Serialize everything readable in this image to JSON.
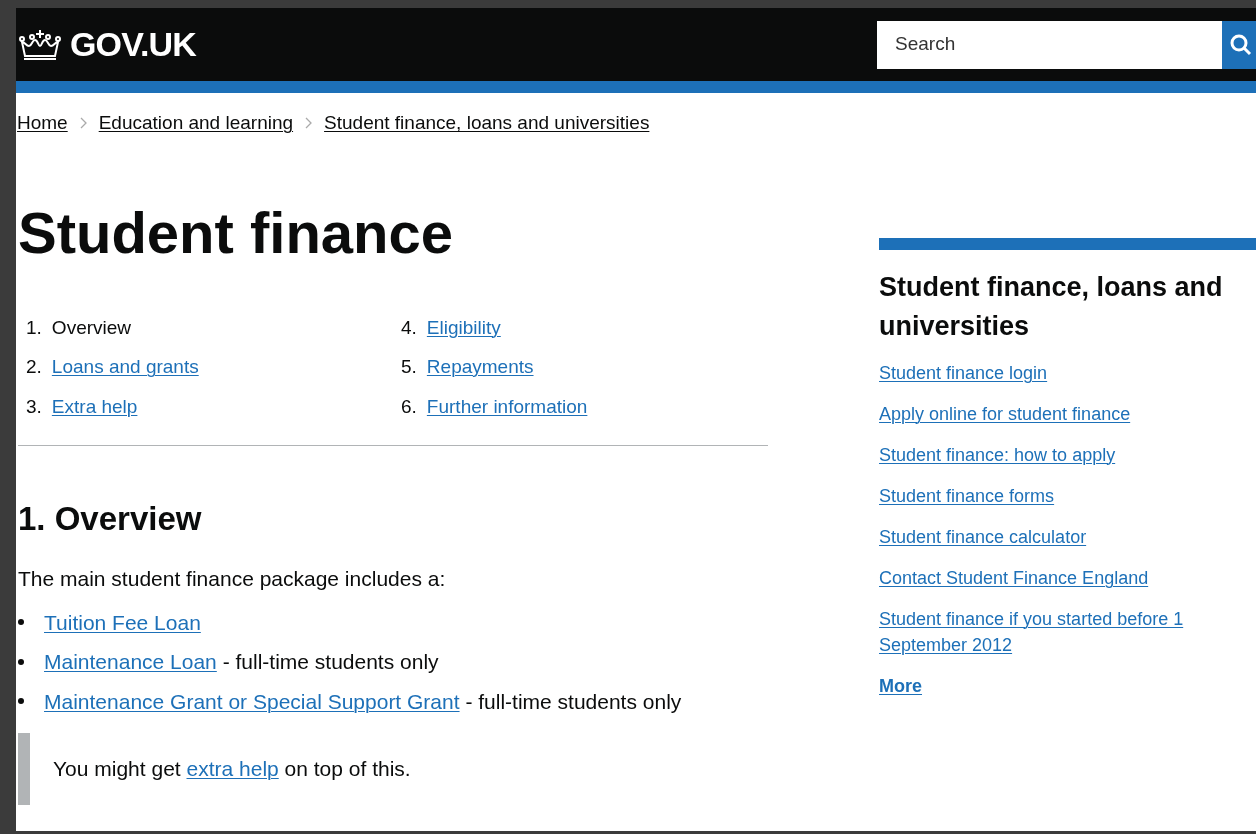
{
  "header": {
    "logo": "GOV.UK",
    "search": {
      "placeholder": "Search"
    }
  },
  "breadcrumbs": [
    "Home",
    "Education and learning",
    "Student finance, loans and universities"
  ],
  "title": "Student finance",
  "contents": [
    {
      "number": "1.",
      "label": "Overview",
      "selected": true
    },
    {
      "number": "2.",
      "label": "Loans and grants",
      "selected": false
    },
    {
      "number": "3.",
      "label": "Extra help",
      "selected": false
    },
    {
      "number": "4.",
      "label": "Eligibility",
      "selected": false
    },
    {
      "number": "5.",
      "label": "Repayments",
      "selected": false
    },
    {
      "number": "6.",
      "label": "Further information",
      "selected": false
    }
  ],
  "section": {
    "heading": "1. Overview",
    "intro": "The main student finance package includes a:",
    "bullets": [
      {
        "link": "Tuition Fee Loan"
      },
      {
        "link": "Maintenance Loan",
        "rest": " - full-time students only"
      },
      {
        "link": "Maintenance Grant or Special Support Grant",
        "rest": " - full-time students only"
      }
    ],
    "inset": {
      "before": "You might get ",
      "link": "extra help",
      "after": " on top of this."
    }
  },
  "sidebar": {
    "heading": "Student finance, loans and universities",
    "links": [
      "Student finance login",
      "Apply online for student finance",
      "Student finance: how to apply",
      "Student finance forms",
      "Student finance calculator",
      "Contact Student Finance England",
      "Student finance if you started before 1 September 2012"
    ],
    "more": "More"
  }
}
